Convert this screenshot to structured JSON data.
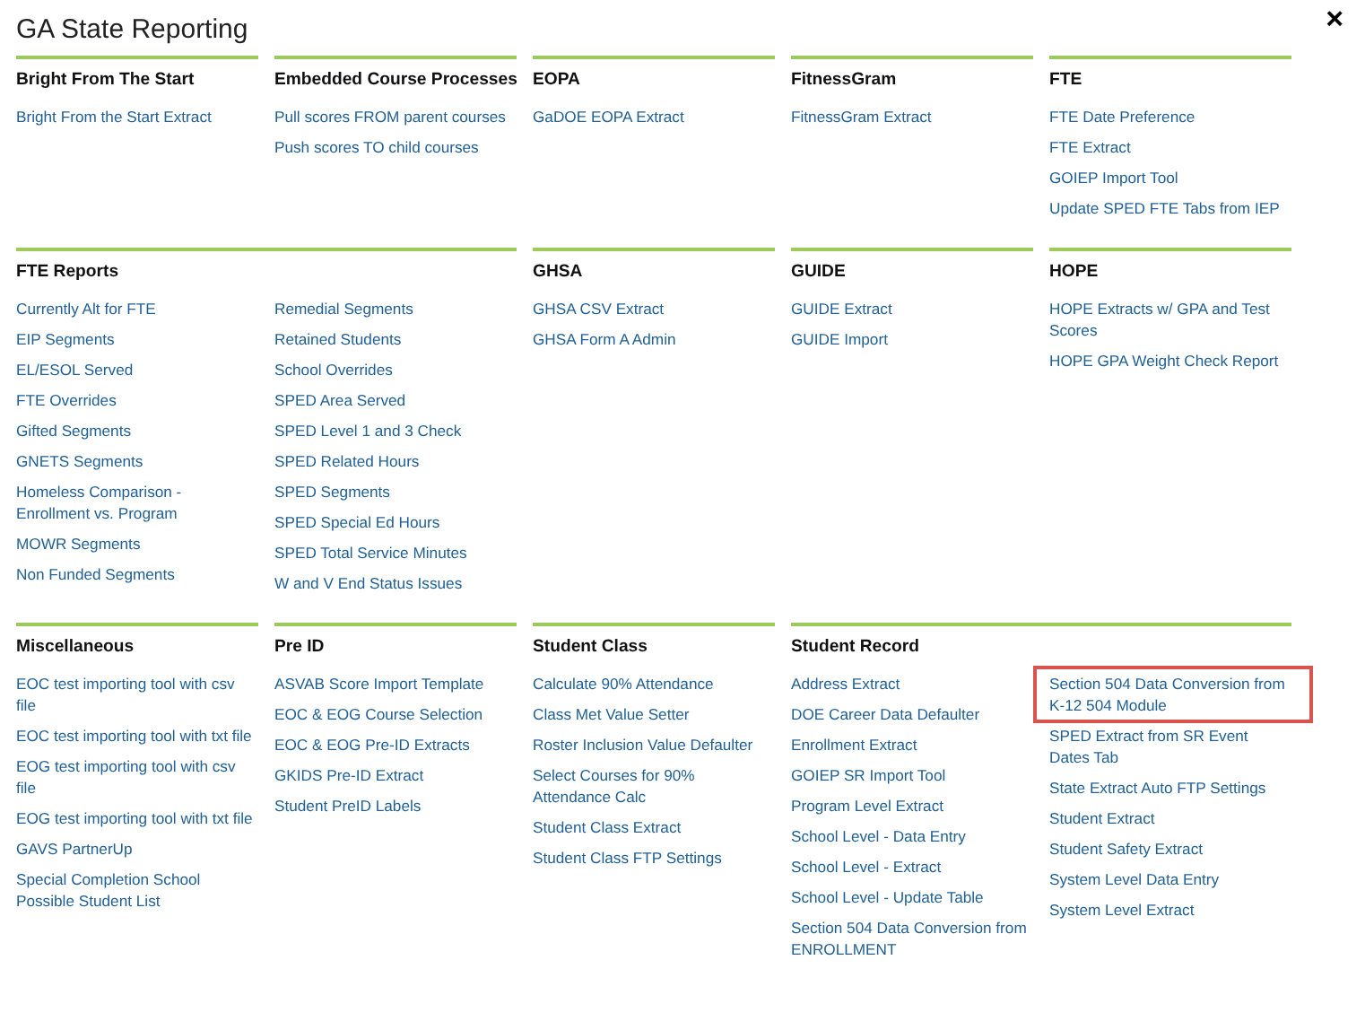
{
  "window": {
    "title": "GA State Reporting",
    "close": "×"
  },
  "rows": [
    [
      {
        "title": "Bright From The Start",
        "columns": [
          [
            {
              "label": "Bright From the Start Extract",
              "highlighted": false
            }
          ]
        ]
      },
      {
        "title": "Embedded Course Processes",
        "columns": [
          [
            {
              "label": "Pull scores FROM parent courses",
              "highlighted": false
            },
            {
              "label": "Push scores TO child courses",
              "highlighted": false
            }
          ]
        ]
      },
      {
        "title": "EOPA",
        "columns": [
          [
            {
              "label": "GaDOE EOPA Extract",
              "highlighted": false
            }
          ]
        ]
      },
      {
        "title": "FitnessGram",
        "columns": [
          [
            {
              "label": "FitnessGram Extract",
              "highlighted": false
            }
          ]
        ]
      },
      {
        "title": "FTE",
        "columns": [
          [
            {
              "label": "FTE Date Preference",
              "highlighted": false
            },
            {
              "label": "FTE Extract",
              "highlighted": false
            },
            {
              "label": "GOIEP Import Tool",
              "highlighted": false
            },
            {
              "label": "Update SPED FTE Tabs from IEP",
              "highlighted": false
            }
          ]
        ]
      }
    ],
    [
      {
        "title": "FTE Reports",
        "columns": [
          [
            {
              "label": "Currently Alt for FTE",
              "highlighted": false
            },
            {
              "label": "EIP Segments",
              "highlighted": false
            },
            {
              "label": "EL/ESOL Served",
              "highlighted": false
            },
            {
              "label": "FTE Overrides",
              "highlighted": false
            },
            {
              "label": "Gifted Segments",
              "highlighted": false
            },
            {
              "label": "GNETS Segments",
              "highlighted": false
            },
            {
              "label": "Homeless Comparison - Enrollment vs. Program",
              "highlighted": false
            },
            {
              "label": "MOWR Segments",
              "highlighted": false
            },
            {
              "label": "Non Funded Segments",
              "highlighted": false
            }
          ],
          [
            {
              "label": "Remedial Segments",
              "highlighted": false
            },
            {
              "label": "Retained Students",
              "highlighted": false
            },
            {
              "label": "School Overrides",
              "highlighted": false
            },
            {
              "label": "SPED Area Served",
              "highlighted": false
            },
            {
              "label": "SPED Level 1 and 3 Check",
              "highlighted": false
            },
            {
              "label": "SPED Related Hours",
              "highlighted": false
            },
            {
              "label": "SPED Segments",
              "highlighted": false
            },
            {
              "label": "SPED Special Ed Hours",
              "highlighted": false
            },
            {
              "label": "SPED Total Service Minutes",
              "highlighted": false
            },
            {
              "label": "W and V End Status Issues",
              "highlighted": false
            }
          ]
        ]
      },
      {
        "title": "GHSA",
        "columns": [
          [
            {
              "label": "GHSA CSV Extract",
              "highlighted": false
            },
            {
              "label": "GHSA Form A Admin",
              "highlighted": false
            }
          ]
        ]
      },
      {
        "title": "GUIDE",
        "columns": [
          [
            {
              "label": "GUIDE Extract",
              "highlighted": false
            },
            {
              "label": "GUIDE Import",
              "highlighted": false
            }
          ]
        ]
      },
      {
        "title": "HOPE",
        "columns": [
          [
            {
              "label": "HOPE Extracts w/ GPA and Test Scores",
              "highlighted": false
            },
            {
              "label": "HOPE GPA Weight Check Report",
              "highlighted": false
            }
          ]
        ]
      }
    ],
    [
      {
        "title": "Miscellaneous",
        "columns": [
          [
            {
              "label": "EOC test importing tool with csv file",
              "highlighted": false
            },
            {
              "label": "EOC test importing tool with txt file",
              "highlighted": false
            },
            {
              "label": "EOG test importing tool with csv file",
              "highlighted": false
            },
            {
              "label": "EOG test importing tool with txt file",
              "highlighted": false
            },
            {
              "label": "GAVS PartnerUp",
              "highlighted": false
            },
            {
              "label": "Special Completion School Possible Student List",
              "highlighted": false
            }
          ]
        ]
      },
      {
        "title": "Pre ID",
        "columns": [
          [
            {
              "label": "ASVAB Score Import Template",
              "highlighted": false
            },
            {
              "label": "EOC & EOG Course Selection",
              "highlighted": false
            },
            {
              "label": "EOC & EOG Pre-ID Extracts",
              "highlighted": false
            },
            {
              "label": "GKIDS Pre-ID Extract",
              "highlighted": false
            },
            {
              "label": "Student PreID Labels",
              "highlighted": false
            }
          ]
        ]
      },
      {
        "title": "Student Class",
        "columns": [
          [
            {
              "label": "Calculate 90% Attendance",
              "highlighted": false
            },
            {
              "label": "Class Met Value Setter",
              "highlighted": false
            },
            {
              "label": "Roster Inclusion Value Defaulter",
              "highlighted": false
            },
            {
              "label": "Select Courses for 90% Attendance Calc",
              "highlighted": false
            },
            {
              "label": "Student Class Extract",
              "highlighted": false
            },
            {
              "label": "Student Class FTP Settings",
              "highlighted": false
            }
          ]
        ]
      },
      {
        "title": "Student Record",
        "columns": [
          [
            {
              "label": "Address Extract",
              "highlighted": false
            },
            {
              "label": "DOE Career Data Defaulter",
              "highlighted": false
            },
            {
              "label": "Enrollment Extract",
              "highlighted": false
            },
            {
              "label": "GOIEP SR Import Tool",
              "highlighted": false
            },
            {
              "label": "Program Level Extract",
              "highlighted": false
            },
            {
              "label": "School Level - Data Entry",
              "highlighted": false
            },
            {
              "label": "School Level - Extract",
              "highlighted": false
            },
            {
              "label": "School Level - Update Table",
              "highlighted": false
            },
            {
              "label": "Section 504 Data Conversion from ENROLLMENT",
              "highlighted": false
            }
          ],
          [
            {
              "label": "Section 504 Data Conversion from K-12 504 Module",
              "highlighted": true
            },
            {
              "label": "SPED Extract from SR Event Dates Tab",
              "highlighted": false
            },
            {
              "label": "State Extract Auto FTP Settings",
              "highlighted": false
            },
            {
              "label": "Student Extract",
              "highlighted": false
            },
            {
              "label": "Student Safety Extract",
              "highlighted": false
            },
            {
              "label": "System Level Data Entry",
              "highlighted": false
            },
            {
              "label": "System Level Extract",
              "highlighted": false
            }
          ]
        ]
      }
    ]
  ]
}
